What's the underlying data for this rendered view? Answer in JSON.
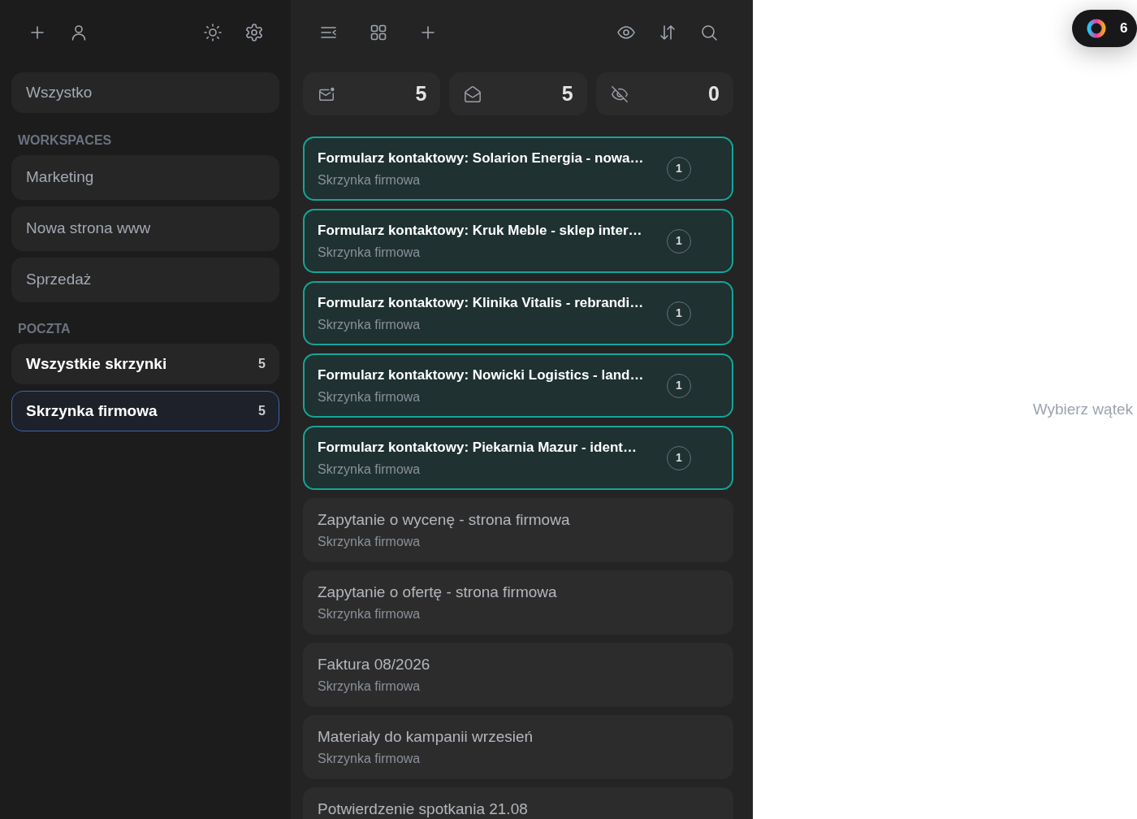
{
  "sidebar": {
    "all": {
      "label": "Wszystko",
      "selected": false
    },
    "workspaces": {
      "heading": "WORKSPACES",
      "items": [
        {
          "label": "Marketing",
          "selected": false
        },
        {
          "label": "Nowa strona www",
          "selected": false
        },
        {
          "label": "Sprzedaż",
          "selected": false
        }
      ]
    },
    "mail": {
      "heading": "POCZTA",
      "items": [
        {
          "label": "Wszystkie skrzynki",
          "count": "5",
          "selected": false
        },
        {
          "label": "Skrzynka firmowa",
          "count": "5",
          "selected": true
        }
      ]
    }
  },
  "stats": [
    {
      "kind": "unread",
      "count": "5"
    },
    {
      "kind": "read",
      "count": "5"
    },
    {
      "kind": "hidden",
      "count": "0"
    }
  ],
  "threads": [
    {
      "title": "Formularz kontaktowy: Solarion Energia - nowa…",
      "mailbox": "Skrzynka firmowa",
      "unread": true,
      "messages": "1"
    },
    {
      "title": "Formularz kontaktowy: Kruk Meble - sklep inter…",
      "mailbox": "Skrzynka firmowa",
      "unread": true,
      "messages": "1"
    },
    {
      "title": "Formularz kontaktowy: Klinika Vitalis - rebrandi…",
      "mailbox": "Skrzynka firmowa",
      "unread": true,
      "messages": "1"
    },
    {
      "title": "Formularz kontaktowy: Nowicki Logistics - land…",
      "mailbox": "Skrzynka firmowa",
      "unread": true,
      "messages": "1"
    },
    {
      "title": "Formularz kontaktowy: Piekarnia Mazur - ident…",
      "mailbox": "Skrzynka firmowa",
      "unread": true,
      "messages": "1"
    },
    {
      "title": "Zapytanie o wycenę - strona firmowa",
      "mailbox": "Skrzynka firmowa",
      "unread": false
    },
    {
      "title": "Zapytanie o ofertę - strona firmowa",
      "mailbox": "Skrzynka firmowa",
      "unread": false
    },
    {
      "title": "Faktura 08/2026",
      "mailbox": "Skrzynka firmowa",
      "unread": false
    },
    {
      "title": "Materiały do kampanii wrzesień",
      "mailbox": "Skrzynka firmowa",
      "unread": false
    },
    {
      "title": "Potwierdzenie spotkania 21.08",
      "unread": false
    }
  ],
  "detail": {
    "empty_message": "Wybierz wątek"
  },
  "floating_widget": {
    "count": "6"
  }
}
